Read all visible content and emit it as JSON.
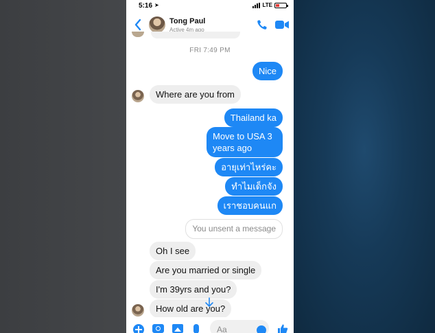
{
  "status_bar": {
    "time": "5:16",
    "location_glyph": "➤",
    "network": "LTE"
  },
  "header": {
    "contact_name": "Tong Paul",
    "active_status": "Active 4m ago"
  },
  "timestamp": "FRI 7:49 PM",
  "messages": [
    {
      "dir": "out",
      "text": "Nice"
    },
    {
      "dir": "in",
      "text": "Where are you from"
    },
    {
      "dir": "out",
      "text": "Thailand ka"
    },
    {
      "dir": "out",
      "text_line1": "Move to USA 3",
      "text_line2": "years ago"
    },
    {
      "dir": "out",
      "text": "อายุเท่าไหร่คะ"
    },
    {
      "dir": "out",
      "text": "ทำไมเด็กจัง"
    },
    {
      "dir": "out",
      "text": "เราชอบคนแก"
    },
    {
      "dir": "system",
      "text": "You unsent a message"
    },
    {
      "dir": "in",
      "text": "Oh I see"
    },
    {
      "dir": "in",
      "text": "Are you married or single"
    },
    {
      "dir": "in",
      "text": "I'm 39yrs and you?"
    },
    {
      "dir": "in",
      "text": "How old are you?"
    }
  ],
  "composer": {
    "placeholder": "Aa"
  },
  "colors": {
    "accent": "#1e88f5",
    "incoming_bubble": "#eeeeee"
  },
  "icons": [
    "back-chevron-icon",
    "phone-icon",
    "video-icon",
    "plus-icon",
    "camera-icon",
    "photo-icon",
    "mic-icon",
    "emoji-icon",
    "like-icon",
    "arrow-down-icon"
  ]
}
